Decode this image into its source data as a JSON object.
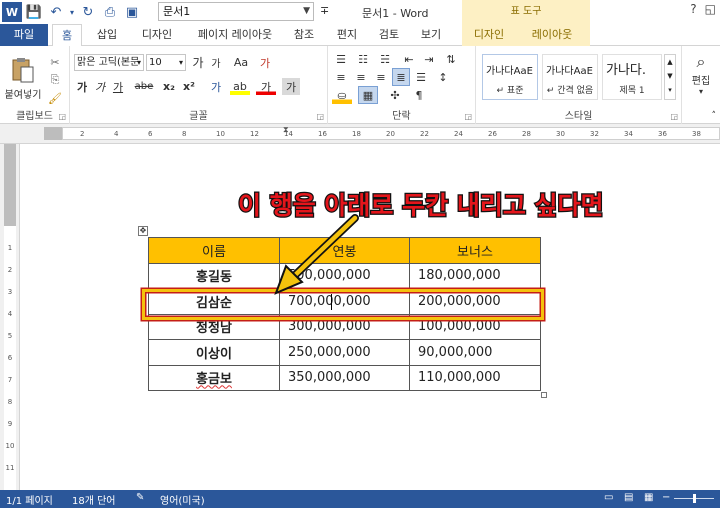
{
  "titlebar": {
    "doc_name": "문서1",
    "window_title": "문서1 - Word",
    "tool_context": "표 도구",
    "help": "?",
    "restore": "◱"
  },
  "tabs": [
    "파일",
    "홈",
    "삽입",
    "디자인",
    "페이지 레이아웃",
    "참조",
    "편지",
    "검토",
    "보기",
    "디자인",
    "레이아웃"
  ],
  "ribbon": {
    "clipboard": {
      "paste_label": "붙여넣기",
      "group": "클립보드"
    },
    "font": {
      "name": "맑은 고딕(본문",
      "size": "10",
      "group": "글꼴",
      "grow": "가",
      "shrink": "가",
      "case": "Aa",
      "clear": "가",
      "bold": "가",
      "italic": "가",
      "underline": "가",
      "strike": "abe",
      "sub": "x₂",
      "sup": "x²",
      "effect": "가",
      "highlight": "ab",
      "color": "가",
      "shade": "가"
    },
    "paragraph": {
      "group": "단락"
    },
    "styles": {
      "group": "스타일",
      "items": [
        {
          "sample": "가나다AaE",
          "name": "↵ 표준"
        },
        {
          "sample": "가나다AaE",
          "name": "↵ 간격 없음"
        },
        {
          "sample": "가나다.",
          "name": "제목 1"
        }
      ]
    },
    "editing": {
      "label": "편집"
    }
  },
  "ruler": {
    "numbers": [
      "2",
      "4",
      "6",
      "8",
      "10",
      "12",
      "14",
      "16",
      "18",
      "20",
      "22",
      "24",
      "26",
      "28",
      "30",
      "32",
      "34",
      "36",
      "38"
    ]
  },
  "vruler": {
    "numbers": [
      "1",
      "2",
      "3",
      "4",
      "5",
      "6",
      "7",
      "8",
      "9",
      "10",
      "11"
    ]
  },
  "annotation": {
    "text": "이 행을 아래로 두칸 내리고 싶다면",
    "color": "#e4151b"
  },
  "table": {
    "header": [
      "이름",
      "연봉",
      "보너스"
    ],
    "rows": [
      [
        "홍길동",
        "500,000,000",
        "180,000,000"
      ],
      [
        "김삼순",
        "700,000,000",
        "200,000,000"
      ],
      [
        "정정남",
        "300,000,000",
        "100,000,000"
      ],
      [
        "이상이",
        "250,000,000",
        "90,000,000"
      ],
      [
        "홍금보",
        "350,000,000",
        "110,000,000"
      ]
    ],
    "header_color": "#ffc000"
  },
  "status": {
    "page": "1/1 페이지",
    "words": "18개 단어",
    "lang": "영어(미국)"
  },
  "colors": {
    "accent": "#2b579a",
    "tool_tab": "#fdf0c4"
  }
}
